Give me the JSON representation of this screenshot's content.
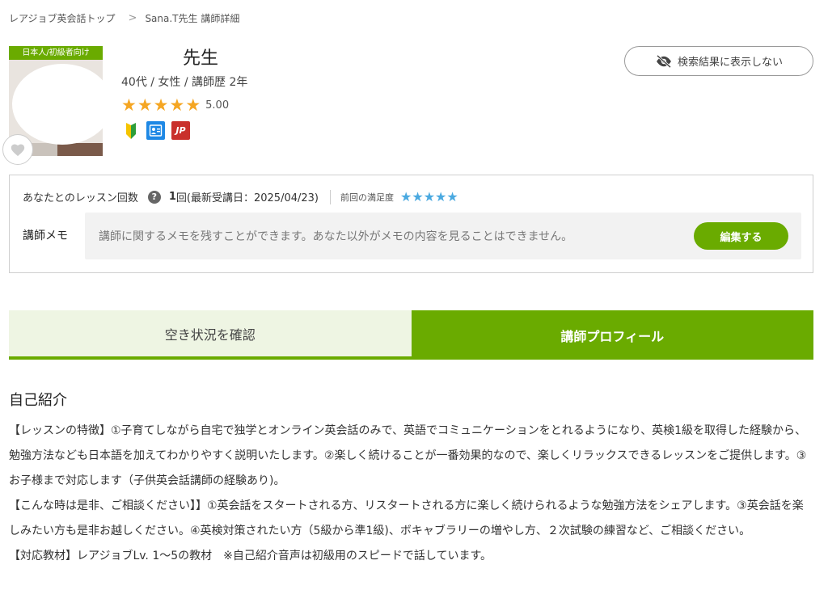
{
  "breadcrumb": {
    "home": "レアジョブ英会話トップ",
    "current": "Sana.T先生 講師詳細"
  },
  "teacher": {
    "tag": "日本人/初級者向け",
    "name": "先生",
    "subtitle": "40代 / 女性 / 講師歴 2年",
    "rating_stars": 5,
    "rating_score": "5.00",
    "badges": [
      "beginner-leaf-icon",
      "id-card-icon",
      "JP"
    ]
  },
  "actions": {
    "hide_label": "検索結果に表示しない"
  },
  "lesson": {
    "label": "あなたとのレッスン回数",
    "help_icon": "?",
    "count": "1",
    "count_detail": "回(最新受講日：2025/04/23)",
    "satisfaction_label": "前回の満足度",
    "satisfaction_stars": 5
  },
  "memo": {
    "label": "講師メモ",
    "placeholder": "講師に関するメモを残すことができます。あなた以外がメモの内容を見ることはできません。",
    "edit_label": "編集する"
  },
  "tabs": [
    {
      "label": "空き状況を確認",
      "active": false
    },
    {
      "label": "講師プロフィール",
      "active": true
    }
  ],
  "profile": {
    "section_title": "自己紹介",
    "paragraphs": [
      "【レッスンの特徴】①子育てしながら自宅で独学とオンライン英会話のみで、英語でコミュニケーションをとれるようになり、英検1級を取得した経験から、勉強方法なども日本語を加えてわかりやすく説明いたします。②楽しく続けることが一番効果的なので、楽しくリラックスできるレッスンをご提供します。③お子様まで対応します（子供英会話講師の経験あり)。",
      "【こんな時は是非、ご相談ください】】①英会話をスタートされる方、リスタートされる方に楽しく続けられるような勉強方法をシェアします。③英会話を楽しみたい方も是非お越しください。④英検対策されたい方（5級から準1級)、ボキャブラリーの増やし方、２次試験の練習など、ご相談ください。",
      "【対応教材】レアジョブLv. 1〜5の教材　※自己紹介音声は初級用のスピードで話しています。"
    ]
  },
  "colors": {
    "brand_green": "#6aab00",
    "star_orange": "#f5a623",
    "star_blue": "#4aa9e0"
  }
}
